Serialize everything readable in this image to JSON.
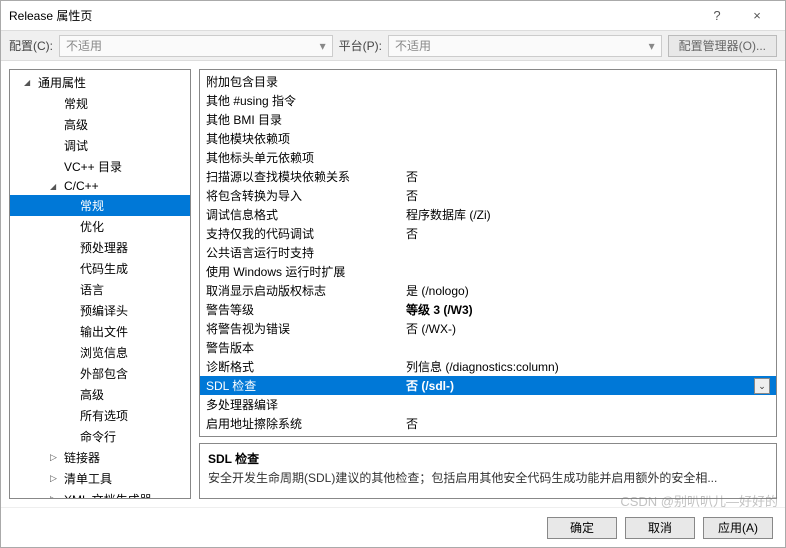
{
  "window": {
    "title": "Release 属性页",
    "help": "?",
    "close": "×"
  },
  "toolbar": {
    "config_label": "配置(C):",
    "config_value": "不适用",
    "platform_label": "平台(P):",
    "platform_value": "不适用",
    "cfgmgr": "配置管理器(O)..."
  },
  "tree": [
    {
      "label": "通用属性",
      "depth": 1,
      "arrow": "open"
    },
    {
      "label": "常规",
      "depth": 2
    },
    {
      "label": "高级",
      "depth": 2
    },
    {
      "label": "调试",
      "depth": 2
    },
    {
      "label": "VC++ 目录",
      "depth": 2
    },
    {
      "label": "C/C++",
      "depth": 2,
      "arrow": "open"
    },
    {
      "label": "常规",
      "depth": 3,
      "sel": true
    },
    {
      "label": "优化",
      "depth": 3
    },
    {
      "label": "预处理器",
      "depth": 3
    },
    {
      "label": "代码生成",
      "depth": 3
    },
    {
      "label": "语言",
      "depth": 3
    },
    {
      "label": "预编译头",
      "depth": 3
    },
    {
      "label": "输出文件",
      "depth": 3
    },
    {
      "label": "浏览信息",
      "depth": 3
    },
    {
      "label": "外部包含",
      "depth": 3
    },
    {
      "label": "高级",
      "depth": 3
    },
    {
      "label": "所有选项",
      "depth": 3
    },
    {
      "label": "命令行",
      "depth": 3
    },
    {
      "label": "链接器",
      "depth": 2,
      "arrow": "closed"
    },
    {
      "label": "清单工具",
      "depth": 2,
      "arrow": "closed"
    },
    {
      "label": "XML 文档生成器",
      "depth": 2,
      "arrow": "closed"
    }
  ],
  "grid": [
    {
      "k": "附加包含目录",
      "v": ""
    },
    {
      "k": "其他 #using 指令",
      "v": ""
    },
    {
      "k": "其他 BMI 目录",
      "v": ""
    },
    {
      "k": "其他模块依赖项",
      "v": ""
    },
    {
      "k": "其他标头单元依赖项",
      "v": ""
    },
    {
      "k": "扫描源以查找模块依赖关系",
      "v": "否"
    },
    {
      "k": "将包含转换为导入",
      "v": "否"
    },
    {
      "k": "调试信息格式",
      "v": "程序数据库 (/Zi)"
    },
    {
      "k": "支持仅我的代码调试",
      "v": "否"
    },
    {
      "k": "公共语言运行时支持",
      "v": ""
    },
    {
      "k": "使用 Windows 运行时扩展",
      "v": ""
    },
    {
      "k": "取消显示启动版权标志",
      "v": "是 (/nologo)"
    },
    {
      "k": "警告等级",
      "v": "等级 3 (/W3)",
      "bold": true
    },
    {
      "k": "将警告视为错误",
      "v": "否 (/WX-)"
    },
    {
      "k": "警告版本",
      "v": ""
    },
    {
      "k": "诊断格式",
      "v": "列信息 (/diagnostics:column)"
    },
    {
      "k": "SDL 检查",
      "v": "否 (/sdl-)",
      "sel": true
    },
    {
      "k": "多处理器编译",
      "v": ""
    },
    {
      "k": "启用地址擦除系统",
      "v": "否"
    }
  ],
  "desc": {
    "title": "SDL 检查",
    "body": "安全开发生命周期(SDL)建议的其他检查；包括启用其他安全代码生成功能并启用额外的安全相..."
  },
  "footer": {
    "ok": "确定",
    "cancel": "取消",
    "apply": "应用(A)"
  },
  "watermark": "CSDN @别叭叭儿—好好的"
}
